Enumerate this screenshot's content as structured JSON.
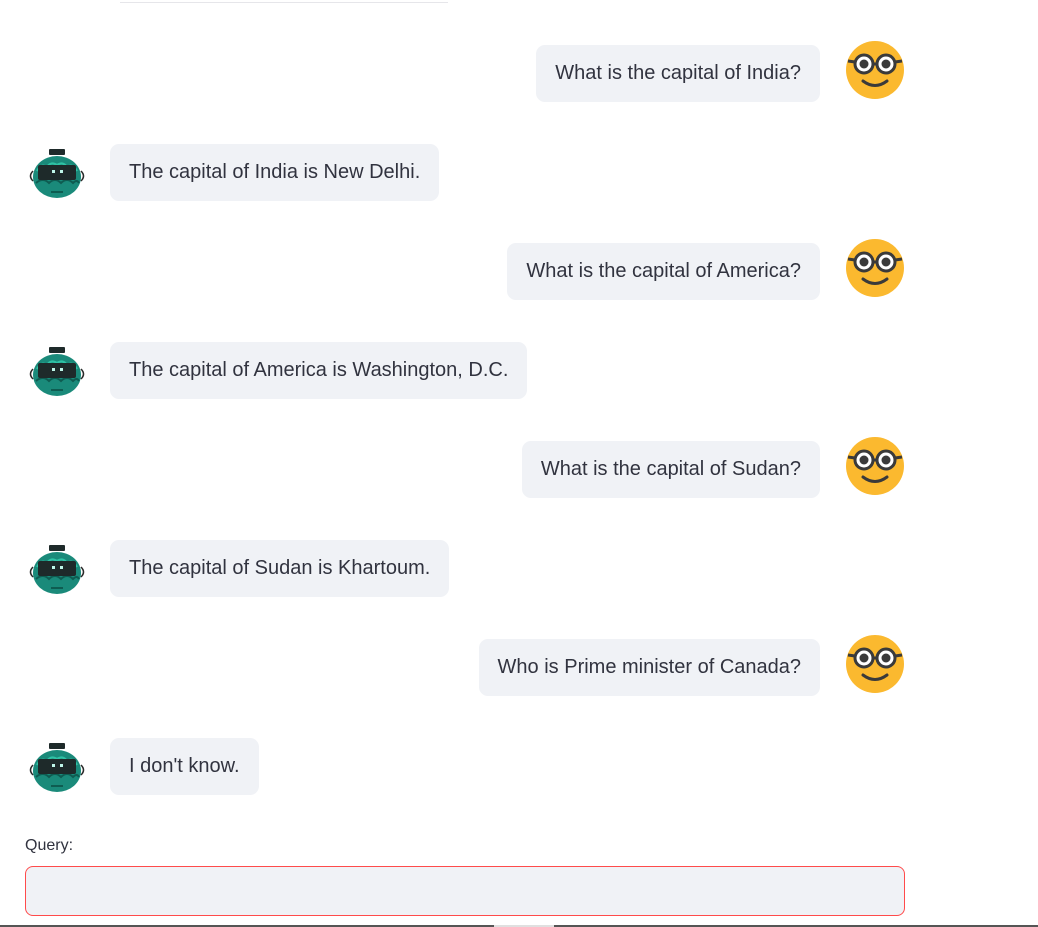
{
  "conversation": {
    "messages": [
      {
        "role": "user",
        "text": "What is the capital of India?"
      },
      {
        "role": "bot",
        "text": "The capital of India is New Delhi."
      },
      {
        "role": "user",
        "text": "What is the capital of America?"
      },
      {
        "role": "bot",
        "text": "The capital of America is Washington, D.C."
      },
      {
        "role": "user",
        "text": "What is the capital of Sudan?"
      },
      {
        "role": "bot",
        "text": "The capital of Sudan is Khartoum."
      },
      {
        "role": "user",
        "text": "Who is Prime minister of Canada?"
      },
      {
        "role": "bot",
        "text": "I don't know."
      }
    ]
  },
  "icons": {
    "user_avatar": "nerd-face-emoji-icon",
    "bot_avatar": "robot-head-icon"
  },
  "query": {
    "label": "Query:",
    "value": "",
    "placeholder": ""
  },
  "colors": {
    "bubble_bg": "#f0f2f6",
    "text": "#31333f",
    "input_border_focus": "#ff4b4b",
    "user_avatar": "#fbb92f",
    "bot_avatar": "#1a8a7a"
  }
}
